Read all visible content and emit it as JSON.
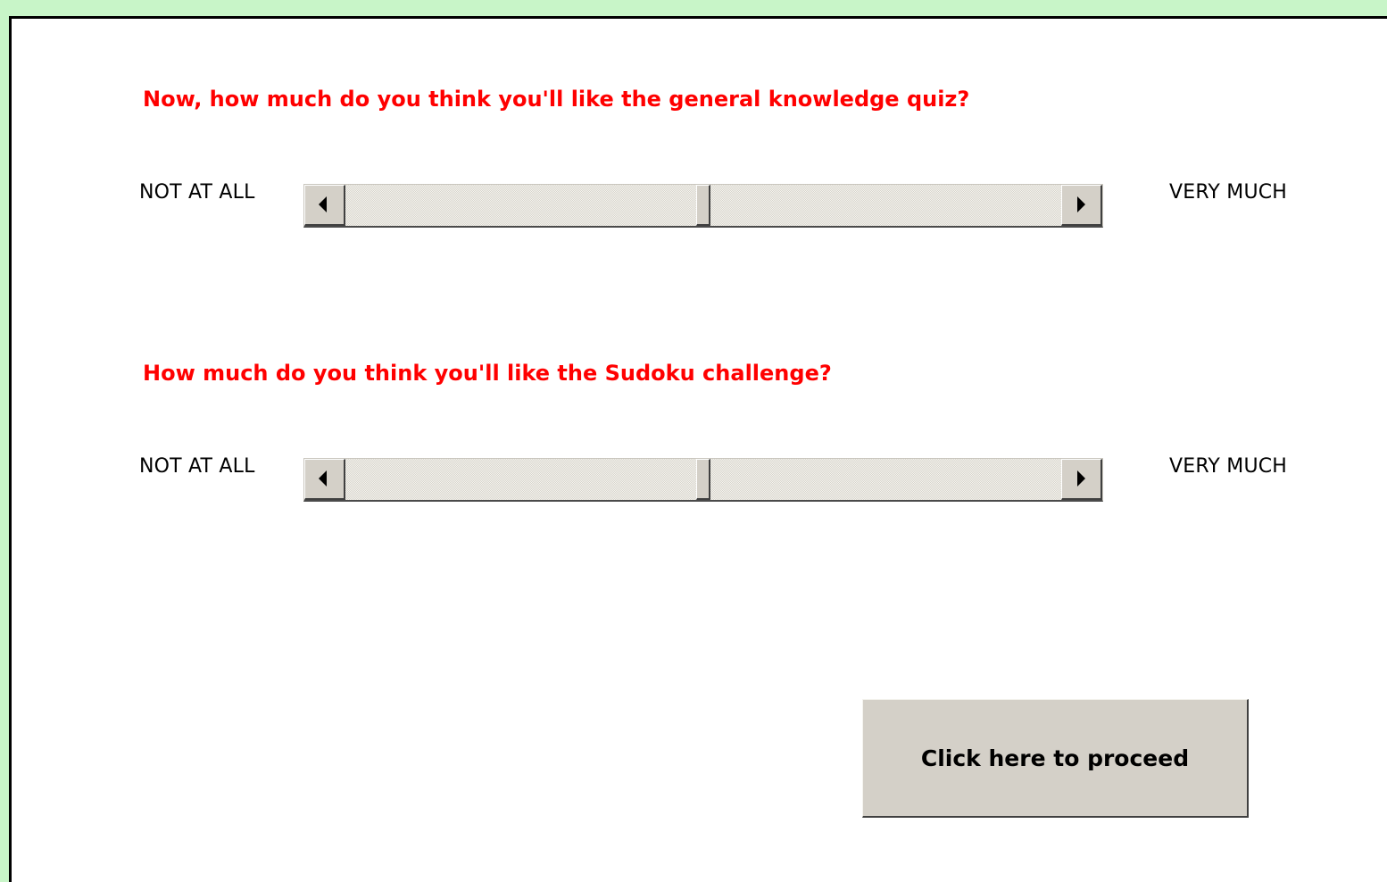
{
  "questions": [
    {
      "text": "Now, how much do you think you'll like the general knowledge quiz?",
      "label_low": "NOT AT ALL",
      "label_high": "VERY MUCH",
      "slider_value": 0.5
    },
    {
      "text": "How much do you think you'll like the Sudoku challenge?",
      "label_low": "NOT AT ALL",
      "label_high": "VERY MUCH",
      "slider_value": 0.5
    }
  ],
  "proceed_button": {
    "label": "Click here to proceed"
  },
  "colors": {
    "page_border": "#c8f5c8",
    "question_text": "#ff0000",
    "control_face": "#d4d0c8"
  },
  "icons": [
    "left-arrow-icon",
    "right-arrow-icon"
  ]
}
